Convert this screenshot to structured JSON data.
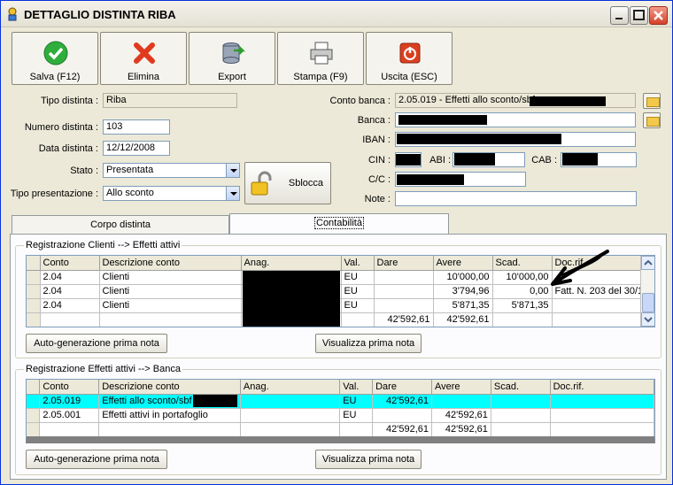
{
  "window": {
    "title": "DETTAGLIO DISTINTA RIBA"
  },
  "toolbar": {
    "save_label": "Salva (F12)",
    "delete_label": "Elimina",
    "export_label": "Export",
    "print_label": "Stampa (F9)",
    "exit_label": "Uscita (ESC)"
  },
  "form": {
    "tipo_distinta_label": "Tipo distinta :",
    "tipo_distinta_value": "Riba",
    "numero_label": "Numero distinta :",
    "numero_value": "103",
    "data_label": "Data distinta :",
    "data_value": "12/12/2008",
    "stato_label": "Stato :",
    "stato_value": "Presentata",
    "tipo_presentazione_label": "Tipo presentazione :",
    "tipo_presentazione_value": "Allo sconto",
    "sblocca_label": "Sblocca",
    "conto_banca_label": "Conto banca :",
    "conto_banca_value": "2.05.019 - Effetti allo sconto/sbf",
    "banca_label": "Banca :",
    "iban_label": "IBAN :",
    "cin_label": "CIN :",
    "abi_label": "ABI :",
    "cab_label": "CAB :",
    "cc_label": "C/C :",
    "note_label": "Note :"
  },
  "tabs": [
    {
      "label": "Corpo distinta"
    },
    {
      "label": "Contabilità"
    }
  ],
  "section1": {
    "title": "Registrazione Clienti --> Effetti attivi",
    "columns": [
      "Conto",
      "Descrizione conto",
      "Anag.",
      "Val.",
      "Dare",
      "Avere",
      "Scad.",
      "Doc.rif."
    ],
    "rows": [
      [
        "2.04",
        "Clienti",
        "",
        "EU",
        "",
        "10'000,00",
        "10'000,00",
        ""
      ],
      [
        "2.04",
        "Clienti",
        "",
        "EU",
        "",
        "3'794,96",
        "0,00",
        "Fatt. N. 203 del 30/1"
      ],
      [
        "2.04",
        "Clienti",
        "",
        "EU",
        "",
        "5'871,35",
        "5'871,35",
        ""
      ],
      [
        "",
        "",
        "",
        "",
        "42'592,61",
        "42'592,61",
        "",
        ""
      ]
    ],
    "auto_btn": "Auto-generazione prima nota",
    "view_btn": "Visualizza prima nota"
  },
  "section2": {
    "title": "Registrazione Effetti attivi --> Banca",
    "columns": [
      "Conto",
      "Descrizione conto",
      "Anag.",
      "Val.",
      "Dare",
      "Avere",
      "Scad.",
      "Doc.rif."
    ],
    "rows": [
      [
        "2.05.019",
        "Effetti allo sconto/sbf",
        "",
        "EU",
        "42'592,61",
        "",
        "",
        ""
      ],
      [
        "2.05.001",
        "Effetti attivi in portafoglio",
        "",
        "EU",
        "",
        "42'592,61",
        "",
        ""
      ],
      [
        "",
        "",
        "",
        "",
        "42'592,61",
        "42'592,61",
        "",
        ""
      ]
    ],
    "auto_btn": "Auto-generazione prima nota",
    "view_btn": "Visualizza prima nota"
  }
}
